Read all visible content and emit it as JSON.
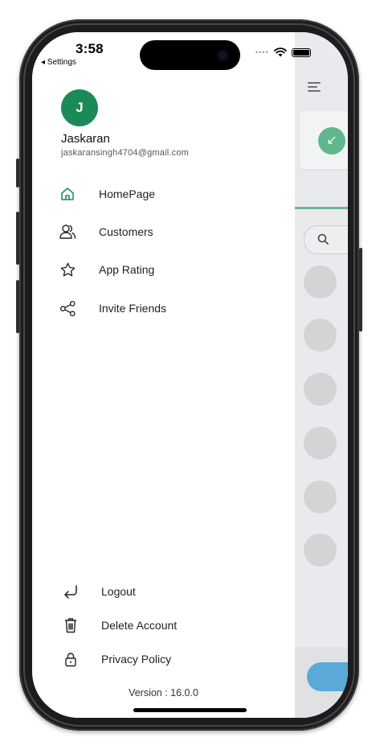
{
  "status": {
    "time": "3:58",
    "back_label": "◂ Settings"
  },
  "profile": {
    "initial": "J",
    "name": "Jaskaran",
    "email": "jaskaransingh4704@gmail.com",
    "avatar_color": "#1a8a56"
  },
  "menu": {
    "items": [
      {
        "label": "HomePage",
        "icon": "home-icon",
        "active": true
      },
      {
        "label": "Customers",
        "icon": "customers-icon"
      },
      {
        "label": "App Rating",
        "icon": "star-icon"
      },
      {
        "label": "Invite Friends",
        "icon": "share-icon"
      }
    ]
  },
  "bottom_menu": {
    "items": [
      {
        "label": "Logout",
        "icon": "logout-icon"
      },
      {
        "label": "Delete Account",
        "icon": "trash-icon"
      },
      {
        "label": "Privacy Policy",
        "icon": "lock-icon"
      }
    ]
  },
  "footer": {
    "version": "Version : 16.0.0"
  },
  "background_app": {
    "search_placeholder": "S",
    "accent": "#6cb696",
    "fab_color": "#5aa9d9"
  },
  "colors": {
    "active_icon": "#1a8a56",
    "icon": "#222222"
  }
}
